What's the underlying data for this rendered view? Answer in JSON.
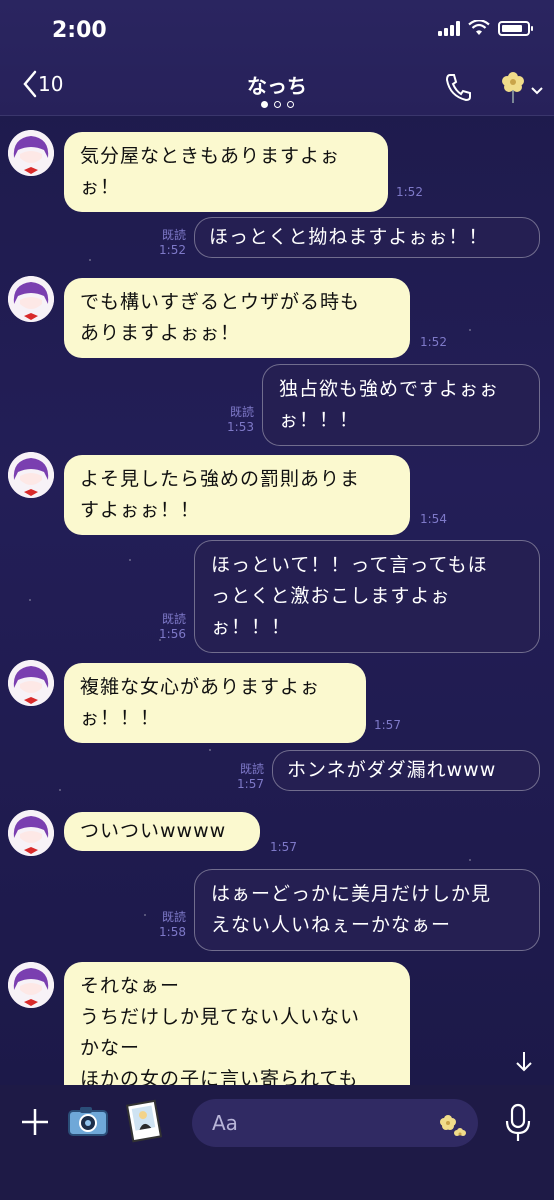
{
  "status_bar": {
    "time": "2:00",
    "battery_level": 0.85
  },
  "header": {
    "back_count": "10",
    "title": "なっち",
    "page_dots": 3,
    "active_dot": 0
  },
  "messages": [
    {
      "side": "in",
      "lines": [
        "気分屋なときもありますよぉ",
        "ぉ！"
      ],
      "time": "1:52"
    },
    {
      "side": "out",
      "lines": [
        "ほっとくと拗ねますよぉぉ！！"
      ],
      "read": "既読",
      "time": "1:52"
    },
    {
      "side": "in",
      "lines": [
        "でも構いすぎるとウザがる時も",
        "ありますよぉぉ！"
      ],
      "time": "1:52"
    },
    {
      "side": "out",
      "lines": [
        "独占欲も強めですよぉぉ",
        "ぉ！！！"
      ],
      "read": "既読",
      "time": "1:53"
    },
    {
      "side": "in",
      "lines": [
        "よそ見したら強めの罰則ありま",
        "すよぉぉ！！"
      ],
      "time": "1:54"
    },
    {
      "side": "out",
      "lines": [
        "ほっといて！！って言ってもほ",
        "っとくと激おこしますよぉ",
        "ぉ！！！"
      ],
      "read": "既読",
      "time": "1:56"
    },
    {
      "side": "in",
      "lines": [
        "複雑な女心がありますよぉ",
        "ぉ！！！"
      ],
      "time": "1:57"
    },
    {
      "side": "out",
      "lines": [
        "ホンネがダダ漏れwww"
      ],
      "read": "既読",
      "time": "1:57"
    },
    {
      "side": "in",
      "lines": [
        "ついついwwww"
      ],
      "time": "1:57"
    },
    {
      "side": "out",
      "lines": [
        "はぁーどっかに美月だけしか見",
        "えない人いねぇーかなぁー"
      ],
      "read": "既読",
      "time": "1:58"
    },
    {
      "side": "in",
      "lines": [
        "それなぁー",
        "うちだけしか見てない人いない",
        "かなー",
        "ほかの女の子に言い寄られても"
      ]
    }
  ],
  "input": {
    "placeholder": "Aa"
  },
  "colors": {
    "accent_bubble": "#fbf9cf",
    "background": "#1d1a4a",
    "meta": "#7e79c8"
  },
  "icons": [
    "back-chevron-icon",
    "phone-icon",
    "flower-icon",
    "plus-icon",
    "camera-icon",
    "photo-icon",
    "sticker-icon",
    "microphone-icon",
    "arrow-down-icon"
  ]
}
